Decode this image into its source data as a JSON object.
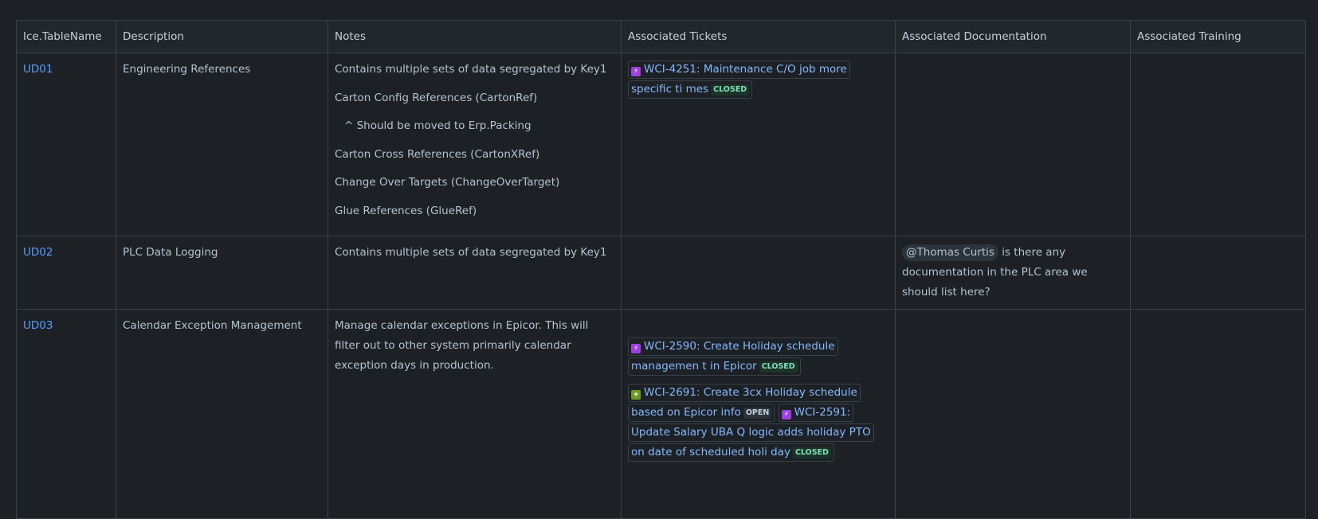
{
  "headers": [
    "Ice.TableName",
    "Description",
    "Notes",
    "Associated Tickets",
    "Associated Documentation",
    "Associated Training"
  ],
  "rows": [
    {
      "table_name": "UD01",
      "description": "Engineering References",
      "notes": [
        "Contains multiple sets of data segregated by Key1",
        "Carton Config References (CartonRef)",
        "^ Should be moved to Erp.Packing",
        "Carton Cross References (CartonXRef)",
        "Change Over Targets (ChangeOverTarget)",
        "Glue References (GlueRef)"
      ],
      "tickets": [
        {
          "icon": "bolt-icon",
          "label": "WCI-4251: Maintenance C/O job more specific ti mes",
          "status": "CLOSED"
        }
      ]
    },
    {
      "table_name": "UD02",
      "description": "PLC Data Logging",
      "notes": [
        "Contains multiple sets of data segregated by Key1"
      ],
      "documentation": {
        "mention": "@Thomas Curtis",
        "text": "is there any documentation in the PLC area we should list here?"
      }
    },
    {
      "table_name": "UD03",
      "description": "Calendar Exception Management",
      "notes_paragraph": "Manage calendar exceptions in Epicor. This will filter out to other system primarily calendar exception days in production.",
      "tickets": [
        {
          "icon": "bolt-icon",
          "label": "WCI-2590: Create Holiday schedule managemen t in Epicor",
          "status": "CLOSED"
        },
        {
          "icon": "plus-icon",
          "label": "WCI-2691: Create 3cx Holiday schedule based on Epicor info",
          "status": "OPEN"
        },
        {
          "icon": "bolt-icon",
          "label": "WCI-2591: Update Salary UBA Q logic adds holiday PTO on date of scheduled holi day",
          "status": "CLOSED"
        }
      ]
    }
  ],
  "colors": {
    "background": "#1d2125",
    "link": "#579dff",
    "ticket_link": "#85b8ff",
    "closed_badge": "#7ee2b8"
  }
}
